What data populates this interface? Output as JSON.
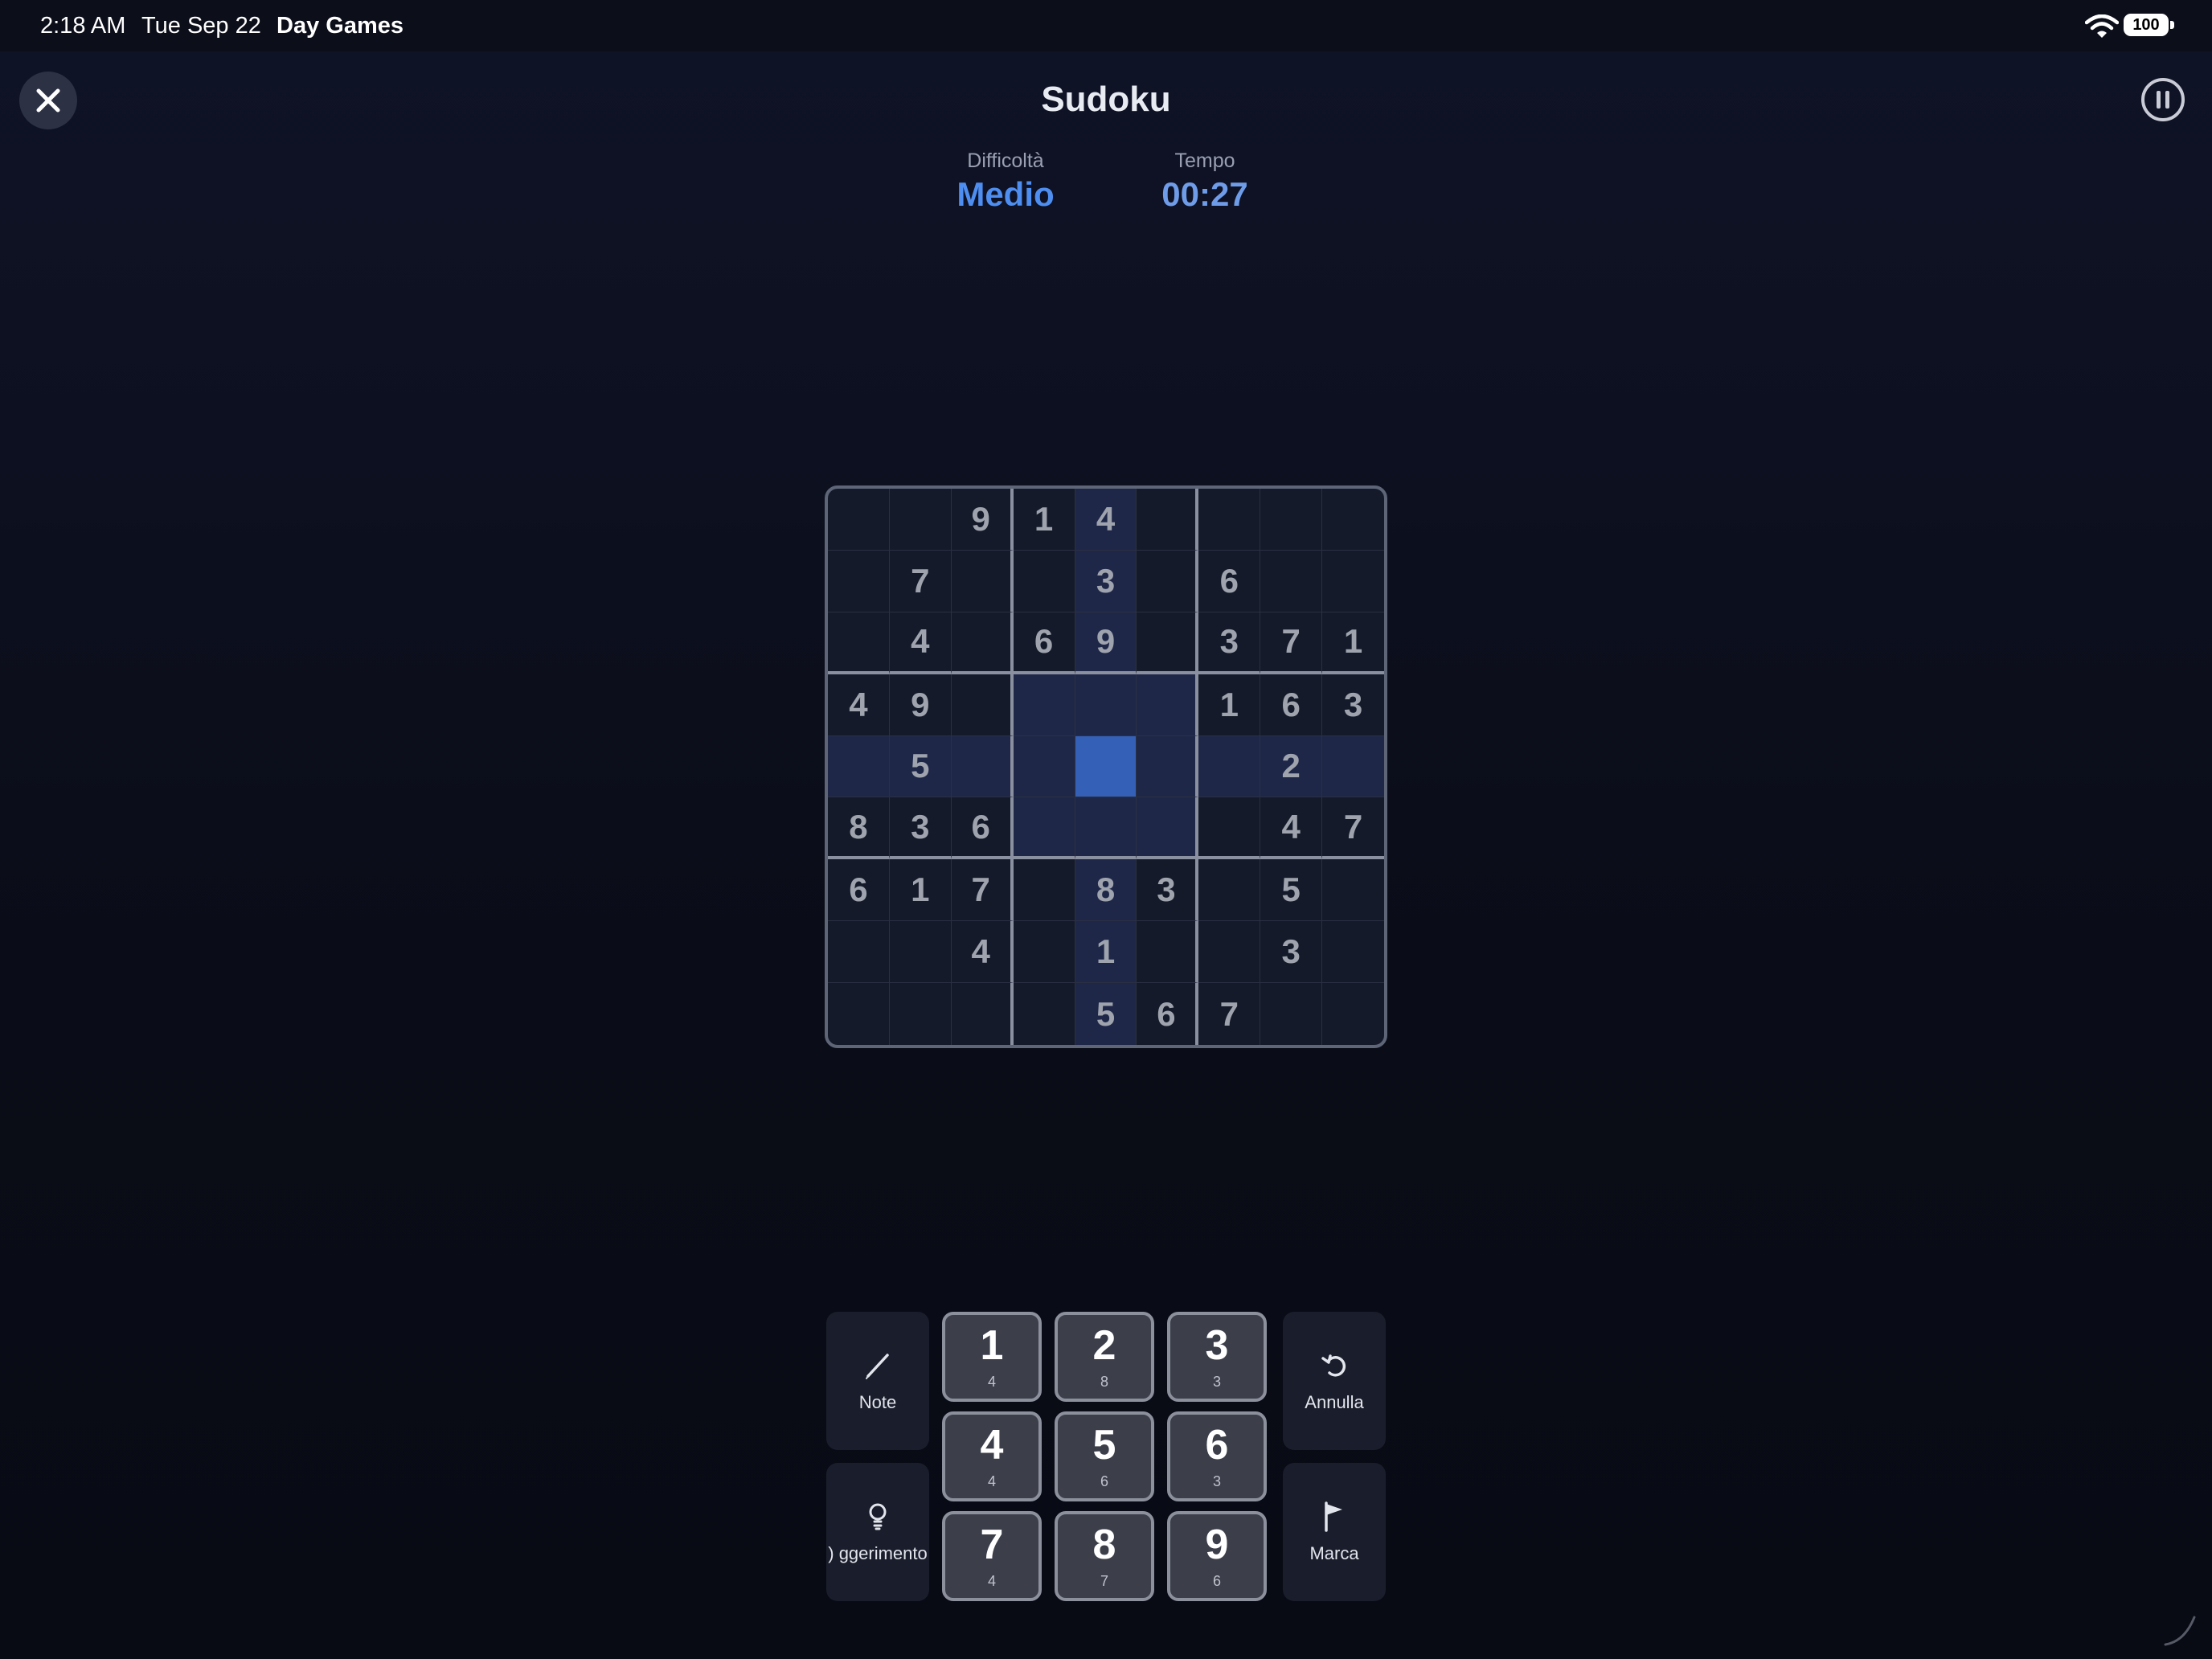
{
  "status_bar": {
    "time": "2:18 AM",
    "date": "Tue Sep 22",
    "app": "Day Games",
    "battery": "100"
  },
  "header": {
    "title": "Sudoku"
  },
  "stats": {
    "difficulty_label": "Difficoltà",
    "difficulty_value": "Medio",
    "time_label": "Tempo",
    "time_value": "00:27"
  },
  "board": {
    "cells": [
      [
        "",
        "",
        "9",
        "1",
        "4",
        "",
        "",
        "",
        ""
      ],
      [
        "",
        "7",
        "",
        "",
        "3",
        "",
        "6",
        "",
        ""
      ],
      [
        "",
        "4",
        "",
        "6",
        "9",
        "",
        "3",
        "7",
        "1"
      ],
      [
        "4",
        "9",
        "",
        "",
        "",
        "",
        "1",
        "6",
        "3"
      ],
      [
        "",
        "5",
        "",
        "",
        "",
        "",
        "",
        "2",
        ""
      ],
      [
        "8",
        "3",
        "6",
        "",
        "",
        "",
        "",
        "4",
        "7"
      ],
      [
        "6",
        "1",
        "7",
        "",
        "8",
        "3",
        "",
        "5",
        ""
      ],
      [
        "",
        "",
        "4",
        "",
        "1",
        "",
        "",
        "3",
        ""
      ],
      [
        "",
        "",
        "",
        "",
        "5",
        "6",
        "7",
        "",
        ""
      ]
    ],
    "selected": {
      "row": 5,
      "col": 5
    }
  },
  "keypad": {
    "numbers": [
      {
        "digit": "1",
        "remaining": "4"
      },
      {
        "digit": "2",
        "remaining": "8"
      },
      {
        "digit": "3",
        "remaining": "3"
      },
      {
        "digit": "4",
        "remaining": "4"
      },
      {
        "digit": "5",
        "remaining": "6"
      },
      {
        "digit": "6",
        "remaining": "3"
      },
      {
        "digit": "7",
        "remaining": "4"
      },
      {
        "digit": "8",
        "remaining": "7"
      },
      {
        "digit": "9",
        "remaining": "6"
      }
    ],
    "note_label": "Note",
    "hint_label": "ggerimento (",
    "undo_label": "Annulla",
    "mark_label": "Marca"
  },
  "colors": {
    "accent": "#4e8ef0",
    "selected_cell": "#3460b8",
    "highlight_cell": "#1e2748"
  },
  "icons": {
    "close": "close-icon",
    "pause": "pause-icon",
    "note": "pencil-icon",
    "hint": "lightbulb-icon",
    "undo": "undo-icon",
    "mark": "flag-icon"
  }
}
